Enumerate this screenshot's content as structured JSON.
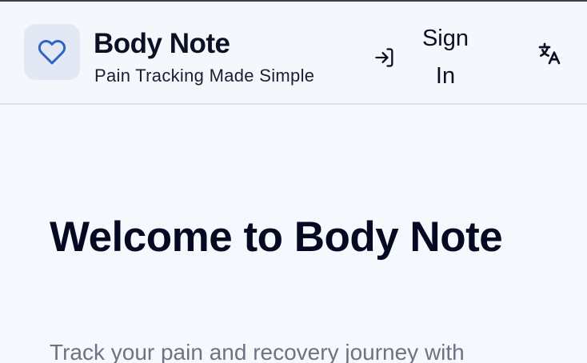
{
  "header": {
    "app_name": "Body Note",
    "tagline": "Pain Tracking Made Simple",
    "signin_label": "Sign In",
    "icons": {
      "logo": "heart-icon",
      "signin": "sign-in-icon",
      "language": "translate-icon"
    }
  },
  "hero": {
    "title": "Welcome to Body Note",
    "description": "Track your pain and recovery journey with"
  },
  "colors": {
    "background": "#f5f8fd",
    "brand_blue": "#2f63c4",
    "logo_bg": "#e2e8f4",
    "heading": "#050a22",
    "muted_text": "#6d7383",
    "divider": "#d7e1ee"
  }
}
